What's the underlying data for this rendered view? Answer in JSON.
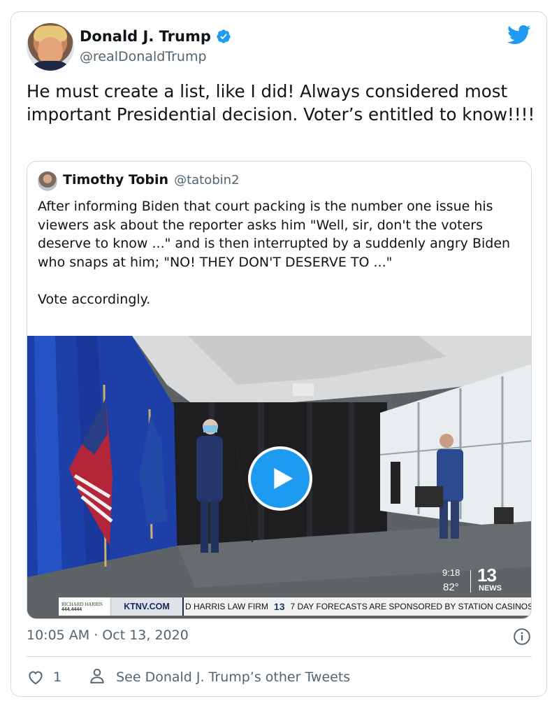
{
  "tweet": {
    "author_name": "Donald J. Trump",
    "author_handle": "@realDonaldTrump",
    "text": "He must create a list, like I did! Always considered most important Presidential decision. Voter’s entitled to know!!!!",
    "timestamp": "10:05 AM · Oct 13, 2020",
    "like_count": "1",
    "other_tweets_label": "See Donald J. Trump’s other Tweets"
  },
  "quoted_tweet": {
    "author_name": "Timothy Tobin",
    "author_handle": "@tatobin2",
    "text": "After informing Biden that court packing is the number one issue his viewers ask about the reporter asks him \"Well, sir, don't the voters deserve to know ...\" and is then interrupted by a suddenly angry Biden who snaps at him; \"NO! THEY DON'T DESERVE TO ...\"\n\nVote accordingly."
  },
  "video_overlay": {
    "time": "9:18",
    "temperature": "82°",
    "station_logo": "13",
    "station_sub": "NEWS",
    "sponsor_name": "RICHARD HARRIS",
    "sponsor_number": "444.4444",
    "site": "KTNV.COM",
    "ticker_left": "D HARRIS LAW FIRM",
    "ticker_logo": "13",
    "ticker_right": "7 DAY FORECASTS ARE SPONSORED BY STATION CASINOS"
  },
  "colors": {
    "brand_blue": "#1d9bf0",
    "secondary_text": "#536471",
    "border": "#cfd9de"
  },
  "icons": [
    "verified-badge-icon",
    "twitter-bird-icon",
    "play-icon",
    "info-icon",
    "heart-icon",
    "person-icon"
  ]
}
